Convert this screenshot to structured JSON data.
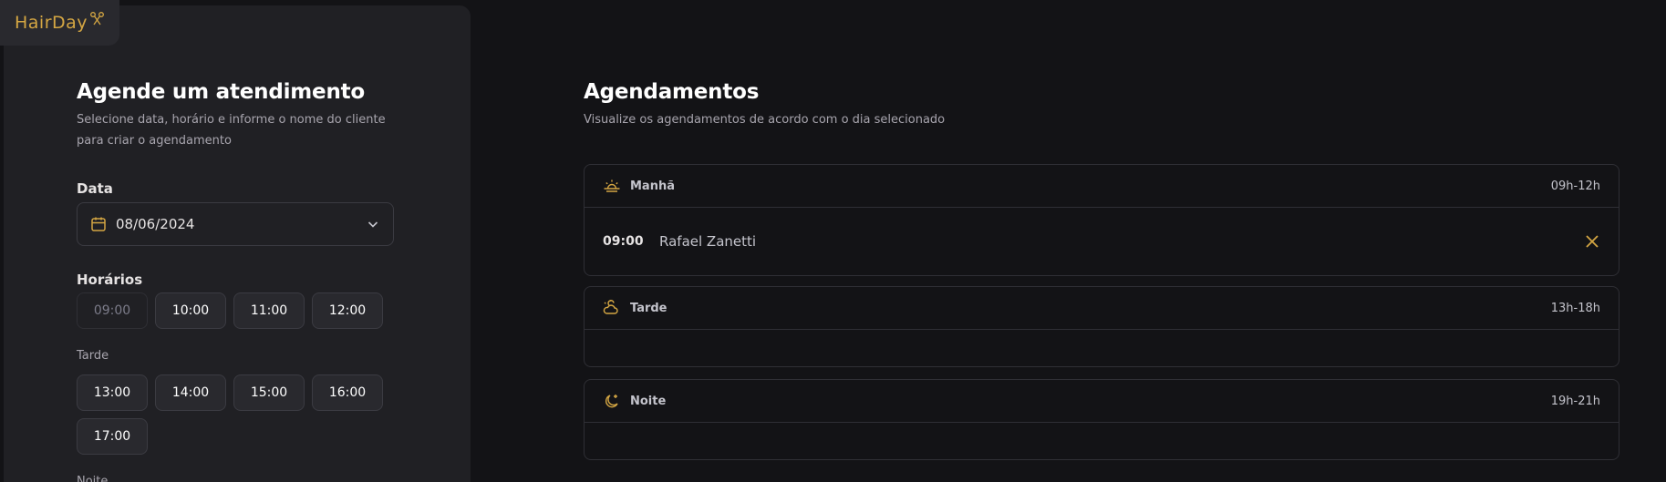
{
  "brand": {
    "name": "HairDay",
    "accent": "#d4a643"
  },
  "form": {
    "title": "Agende um atendimento",
    "subtitle": "Selecione data, horário e informe o nome do cliente para criar o agendamento",
    "date_label": "Data",
    "date_value": "08/06/2024",
    "hours_label": "Horários",
    "morning_hours": [
      {
        "label": "09:00",
        "available": false
      },
      {
        "label": "10:00",
        "available": true
      },
      {
        "label": "11:00",
        "available": true
      },
      {
        "label": "12:00",
        "available": true
      }
    ],
    "afternoon_label": "Tarde",
    "afternoon_hours": [
      {
        "label": "13:00",
        "available": true
      },
      {
        "label": "14:00",
        "available": true
      },
      {
        "label": "15:00",
        "available": true
      },
      {
        "label": "16:00",
        "available": true
      },
      {
        "label": "17:00",
        "available": true
      }
    ],
    "night_label": "Noite"
  },
  "schedule": {
    "title": "Agendamentos",
    "subtitle": "Visualize os agendamentos de acordo com o dia selecionado",
    "periods": [
      {
        "name": "Manhã",
        "range": "09h-12h",
        "icon": "sunrise-icon",
        "appointments": [
          {
            "time": "09:00",
            "client": "Rafael Zanetti"
          }
        ]
      },
      {
        "name": "Tarde",
        "range": "13h-18h",
        "icon": "cloud-sun-icon",
        "appointments": []
      },
      {
        "name": "Noite",
        "range": "19h-21h",
        "icon": "moon-stars-icon",
        "appointments": []
      }
    ]
  }
}
